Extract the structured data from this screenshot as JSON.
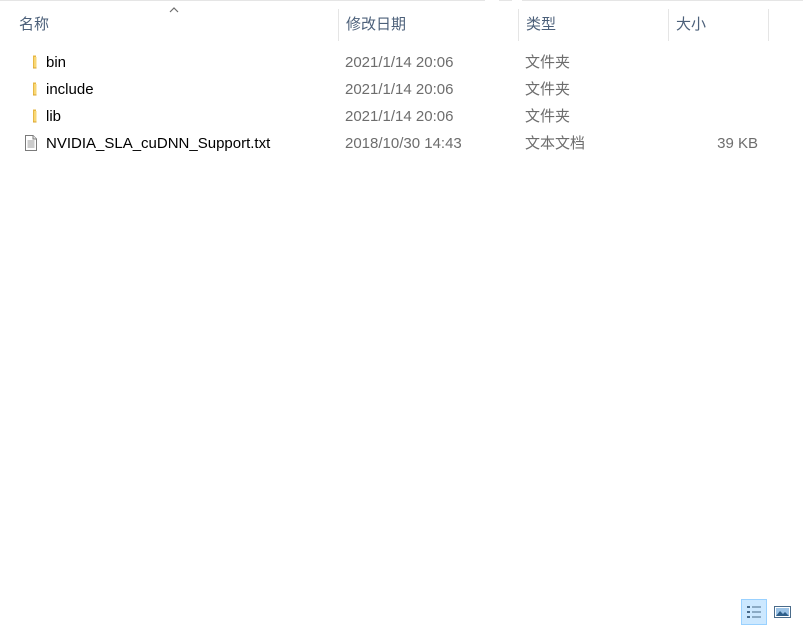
{
  "columns": {
    "name": "名称",
    "date": "修改日期",
    "type": "类型",
    "size": "大小"
  },
  "sort": {
    "column": "name",
    "direction": "ascending",
    "icon": "chevron-up-icon"
  },
  "files": [
    {
      "name": "bin",
      "date": "2021/1/14 20:06",
      "type": "文件夹",
      "size": "",
      "icon": "folder-icon"
    },
    {
      "name": "include",
      "date": "2021/1/14 20:06",
      "type": "文件夹",
      "size": "",
      "icon": "folder-icon"
    },
    {
      "name": "lib",
      "date": "2021/1/14 20:06",
      "type": "文件夹",
      "size": "",
      "icon": "folder-icon"
    },
    {
      "name": "NVIDIA_SLA_cuDNN_Support.txt",
      "date": "2018/10/30 14:43",
      "type": "文本文档",
      "size": "39 KB",
      "icon": "text-file-icon"
    }
  ],
  "view_buttons": {
    "details": {
      "icon": "details-view-icon",
      "active": true
    },
    "thumbnails": {
      "icon": "large-icons-view-icon",
      "active": false
    }
  },
  "colors": {
    "header_text": "#4c607a",
    "secondary_text": "#6d6d6d",
    "folder_yellow": "#f8d775",
    "active_view_bg": "#cce8ff"
  }
}
